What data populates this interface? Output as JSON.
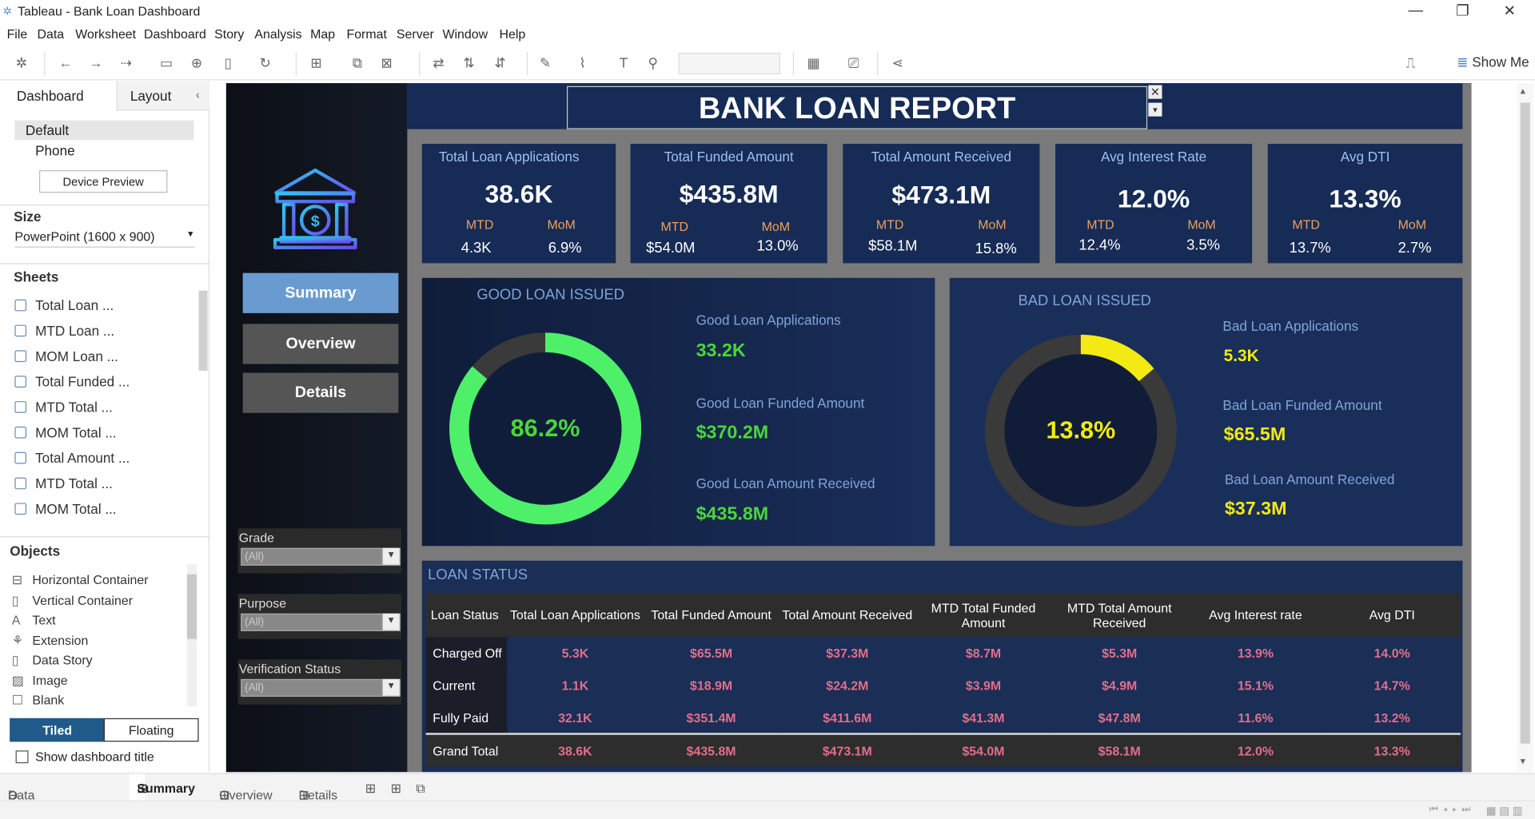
{
  "window": {
    "title": "Tableau - Bank Loan Dashboard"
  },
  "menu": [
    "File",
    "Data",
    "Worksheet",
    "Dashboard",
    "Story",
    "Analysis",
    "Map",
    "Format",
    "Server",
    "Window",
    "Help"
  ],
  "toolbar": {
    "show_me": "Show Me"
  },
  "left_pane": {
    "tabs": [
      "Dashboard",
      "Layout"
    ],
    "devices": [
      "Default",
      "Phone"
    ],
    "device_preview": "Device Preview",
    "size_label": "Size",
    "size_value": "PowerPoint (1600 x 900)",
    "sheets_label": "Sheets",
    "sheets": [
      "Total Loan ...",
      "MTD Loan ...",
      "MOM Loan ...",
      "Total Funded ...",
      "MTD Total ...",
      "MOM Total ...",
      "Total Amount ...",
      "MTD Total ...",
      "MOM Total ..."
    ],
    "objects_label": "Objects",
    "objects": [
      "Horizontal Container",
      "Vertical Container",
      "Text",
      "Extension",
      "Data Story",
      "Image",
      "Blank"
    ],
    "tiled": "Tiled",
    "floating": "Floating",
    "show_title": "Show dashboard title"
  },
  "dashboard": {
    "title": "BANK LOAN REPORT",
    "nav": [
      "Summary",
      "Overview",
      "Details"
    ],
    "filters": [
      {
        "label": "Grade",
        "value": "(All)"
      },
      {
        "label": "Purpose",
        "value": "(All)"
      },
      {
        "label": "Verification Status",
        "value": "(All)"
      }
    ],
    "kpis": [
      {
        "title": "Total  Loan Applications",
        "value": "38.6K",
        "mtd_label": "MTD",
        "mtd": "4.3K",
        "mom_label": "MoM",
        "mom": "6.9%"
      },
      {
        "title": "Total Funded Amount",
        "value": "$435.8M",
        "mtd_label": "MTD",
        "mtd": "$54.0M",
        "mom_label": "MoM",
        "mom": "13.0%"
      },
      {
        "title": "Total Amount Received",
        "value": "$473.1M",
        "mtd_label": "MTD",
        "mtd": "$58.1M",
        "mom_label": "MoM",
        "mom": "15.8%"
      },
      {
        "title": "Avg Interest Rate",
        "value": "12.0%",
        "mtd_label": "MTD",
        "mtd": "12.4%",
        "mom_label": "MoM",
        "mom": "3.5%"
      },
      {
        "title": "Avg DTI",
        "value": "13.3%",
        "mtd_label": "MTD",
        "mtd": "13.7%",
        "mom_label": "MoM",
        "mom": "2.7%"
      }
    ],
    "good": {
      "title": "GOOD LOAN ISSUED",
      "pct_label": "86.2%",
      "pct": 0.862,
      "color": "#4ef06a",
      "items": [
        {
          "label": "Good Loan Applications",
          "value": "33.2K"
        },
        {
          "label": "Good Loan Funded Amount",
          "value": "$370.2M"
        },
        {
          "label": "Good Loan Amount Received",
          "value": "$435.8M"
        }
      ]
    },
    "bad": {
      "title": "BAD LOAN ISSUED",
      "pct_label": "13.8%",
      "pct": 0.138,
      "color": "#f2ea12",
      "items": [
        {
          "label": "Bad Loan Applications",
          "value": "5.3K"
        },
        {
          "label": "Bad Loan Funded Amount",
          "value": "$65.5M"
        },
        {
          "label": "Bad Loan Amount Received",
          "value": "$37.3M"
        }
      ]
    },
    "status": {
      "title": "LOAN STATUS",
      "headers": [
        "Loan Status",
        "Total Loan Applications",
        "Total Funded Amount",
        "Total Amount Received",
        "MTD Total Funded Amount",
        "MTD Total Amount Received",
        "Avg Interest rate",
        "Avg DTI"
      ],
      "rows": [
        [
          "Charged Off",
          "5.3K",
          "$65.5M",
          "$37.3M",
          "$8.7M",
          "$5.3M",
          "13.9%",
          "14.0%"
        ],
        [
          "Current",
          "1.1K",
          "$18.9M",
          "$24.2M",
          "$3.9M",
          "$4.9M",
          "15.1%",
          "14.7%"
        ],
        [
          "Fully Paid",
          "32.1K",
          "$351.4M",
          "$411.6M",
          "$41.3M",
          "$47.8M",
          "11.6%",
          "13.2%"
        ]
      ],
      "total": [
        "Grand Total",
        "38.6K",
        "$435.8M",
        "$473.1M",
        "$54.0M",
        "$58.1M",
        "12.0%",
        "13.3%"
      ]
    }
  },
  "bottom_tabs": [
    "Data Source",
    "Summary",
    "Overview",
    "Details"
  ]
}
